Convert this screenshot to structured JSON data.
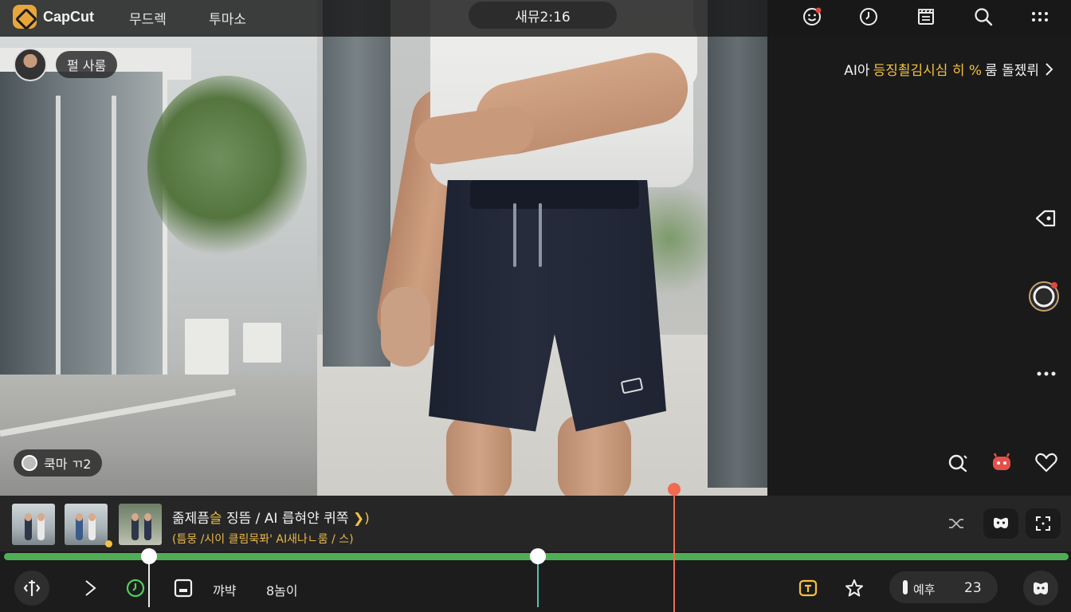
{
  "app": {
    "name": "CapCut"
  },
  "top_tabs": [
    "무드렉",
    "투마소"
  ],
  "timecode": "새뮤2:16",
  "overlay": {
    "user_label": "펄 사룸",
    "bottom_chip": "쿡마 ㄲ2",
    "ai_banner": {
      "prefix": "AI아",
      "highlight": "등징쵤김시심 히 %",
      "suffix": "룸 돌젰뤼"
    }
  },
  "strip": {
    "title_pre": "졺제픔",
    "title_hl": "슬",
    "title_post": " 징뜸 / AI 릅혀얀 퀴쪽",
    "title_arrow": "❯)",
    "subtitle": "(틈뭉 /시이 클림묵퐈' AI새나ㄴ룸 / 스)"
  },
  "toolbar": {
    "label_1": "꺄뱍",
    "label_2": "8놈이",
    "speed_label": "예후",
    "speed_value": "23"
  },
  "colors": {
    "accent": "#f4c23d",
    "track": "#4fae55",
    "playhead": "#f26a4f"
  }
}
